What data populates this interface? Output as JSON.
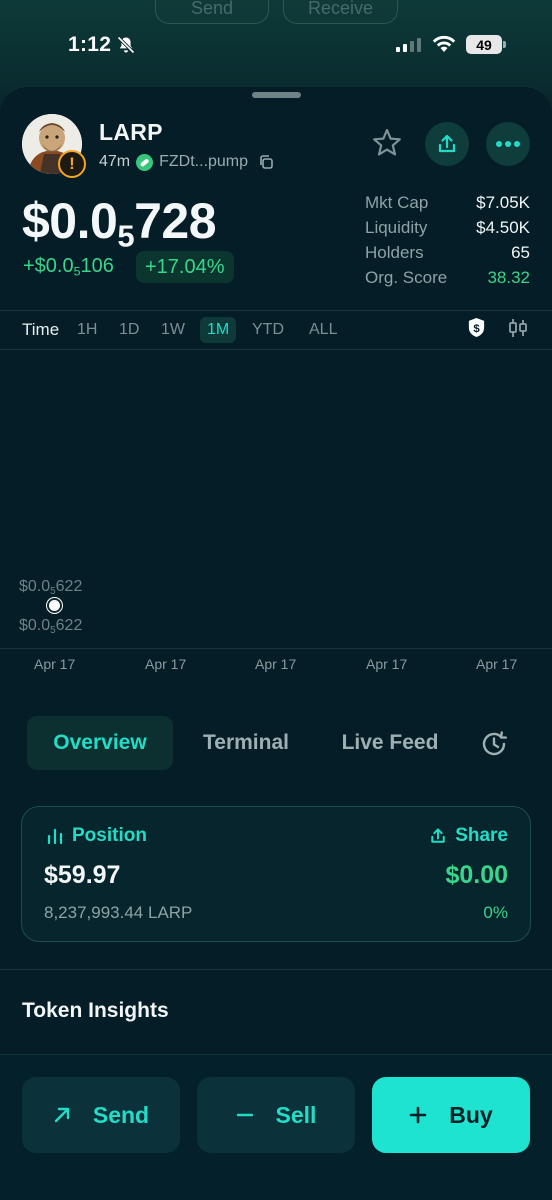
{
  "background_buttons": {
    "send": "Send",
    "receive": "Receive"
  },
  "status_bar": {
    "time": "1:12",
    "battery": "49"
  },
  "token": {
    "name": "LARP",
    "age": "47m",
    "address": "FZDt...pump",
    "price_main": "$0.0",
    "price_sub": "5",
    "price_tail": "728",
    "change_main": "+$0.0",
    "change_sub": "5",
    "change_tail": "106",
    "change_pct": "+17.04%"
  },
  "stats": [
    {
      "label": "Mkt Cap",
      "value": "$7.05K"
    },
    {
      "label": "Liquidity",
      "value": "$4.50K"
    },
    {
      "label": "Holders",
      "value": "65"
    },
    {
      "label": "Org. Score",
      "value": "38.32"
    }
  ],
  "timeframes": {
    "label": "Time",
    "options": [
      "1H",
      "1D",
      "1W",
      "1M",
      "YTD",
      "ALL"
    ],
    "selected": "1M"
  },
  "chart": {
    "upper_label_main": "$0.0",
    "upper_label_sub": "5",
    "upper_label_tail": "622",
    "lower_label_main": "$0.0",
    "lower_label_sub": "5",
    "lower_label_tail": "622",
    "x_labels": [
      "Apr 17",
      "Apr 17",
      "Apr 17",
      "Apr 17",
      "Apr 17"
    ]
  },
  "chart_data": {
    "type": "line",
    "x": [
      "Apr 17"
    ],
    "values": [
      "$0.0₅622"
    ],
    "xlabel": "",
    "ylabel": "",
    "tick_labels_x": [
      "Apr 17",
      "Apr 17",
      "Apr 17",
      "Apr 17",
      "Apr 17"
    ]
  },
  "tabs": {
    "overview": "Overview",
    "terminal": "Terminal",
    "live_feed": "Live Feed",
    "active": "Overview"
  },
  "position": {
    "title": "Position",
    "share": "Share",
    "value": "$59.97",
    "pnl": "$0.00",
    "amount": "8,237,993.44 LARP",
    "pnl_pct": "0%"
  },
  "insights_title": "Token Insights",
  "actions": {
    "send": "Send",
    "sell": "Sell",
    "buy": "Buy"
  },
  "colors": {
    "accent": "#22dcc7",
    "positive": "#38d68b",
    "warning": "#f5a524",
    "background": "#041d26"
  }
}
